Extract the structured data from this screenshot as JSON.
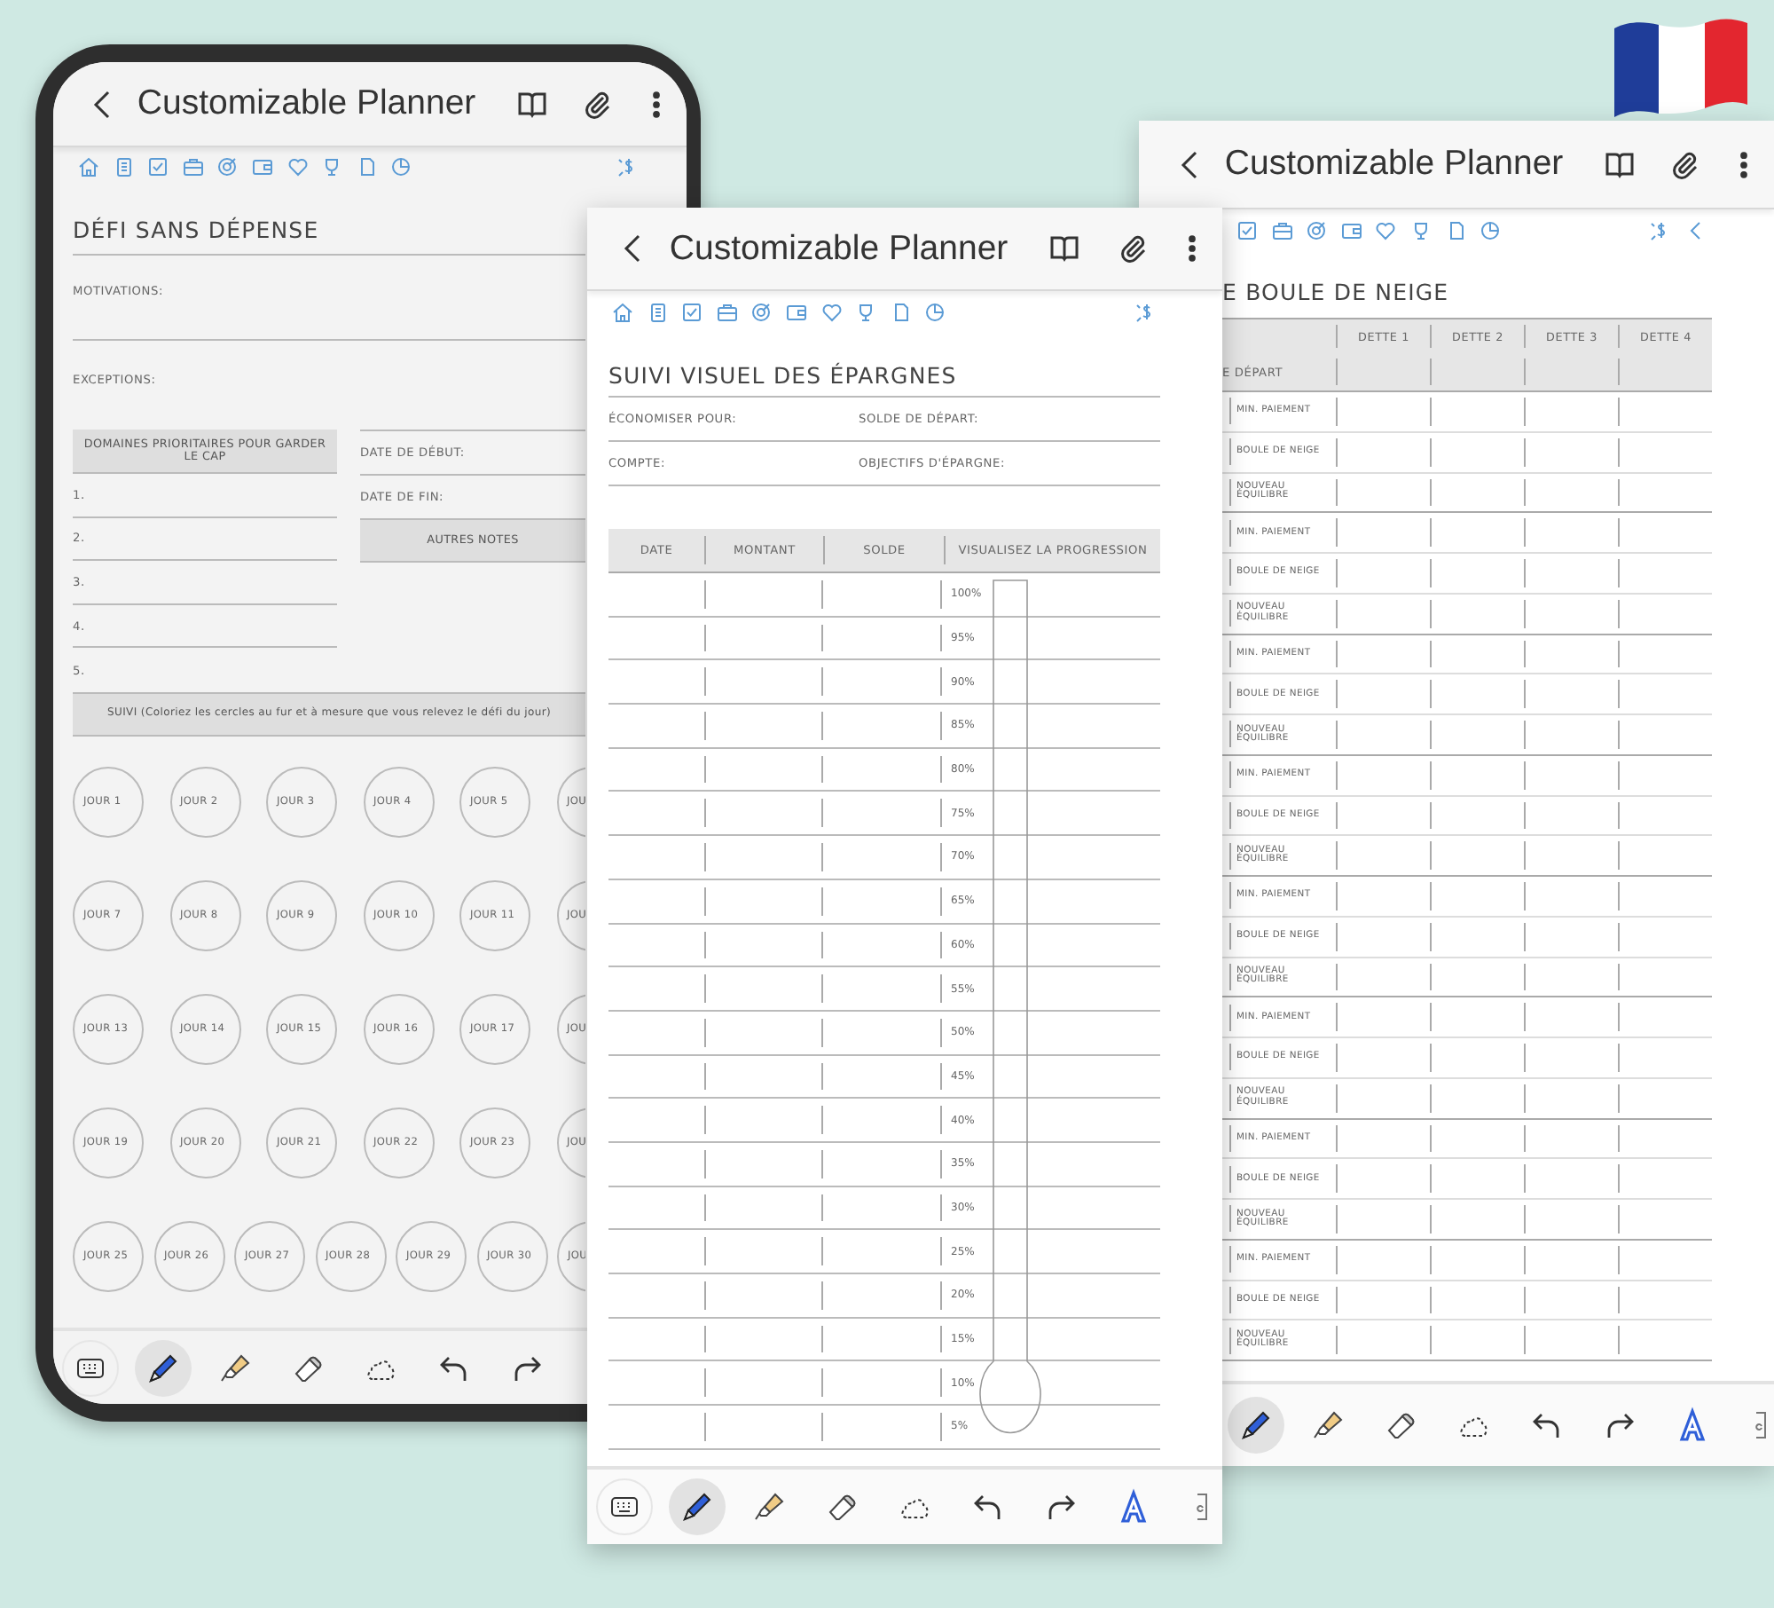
{
  "screens": [
    {
      "kind": "no_spend",
      "title": "Customizable Planner",
      "heading": "DÉFI SANS DÉPENSE",
      "notes": [
        "MOTIVATIONS:",
        "EXCEPTIONS:"
      ],
      "priorities": {
        "header": "DOMAINES PRIORITAIRES POUR GARDER LE CAP",
        "items": [
          "1.",
          "2.",
          "3.",
          "4.",
          "5."
        ]
      },
      "dates": [
        "DATE DE DÉBUT:",
        "DATE DE FIN:"
      ],
      "other_notes": "AUTRES NOTES",
      "tracker": {
        "header": "SUIVI (Coloriez les cercles au fur et à mesure que vous relevez le défi du jour)",
        "rows": [
          {
            "days": [
              "JOUR 1",
              "JOUR 2",
              "JOUR 3",
              "JOUR 4",
              "JOUR 5",
              "JOU"
            ]
          },
          {
            "days": [
              "JOUR 7",
              "JOUR 8",
              "JOUR 9",
              "JOUR 10",
              "JOUR 11",
              "JOU"
            ]
          },
          {
            "days": [
              "JOUR 13",
              "JOUR 14",
              "JOUR 15",
              "JOUR 16",
              "JOUR 17",
              "JOU"
            ]
          },
          {
            "days": [
              "JOUR 19",
              "JOUR 20",
              "JOUR 21",
              "JOUR 22",
              "JOUR 23",
              "JOU"
            ]
          },
          {
            "days": [
              "JOUR 25",
              "JOUR 26",
              "JOUR 27",
              "JOUR 28",
              "JOUR 29",
              "JOUR 30",
              "JOU"
            ]
          }
        ]
      },
      "toolbar": [
        {
          "kind": "keyboard",
          "selected": false
        },
        {
          "kind": "pen",
          "selected": true
        },
        {
          "kind": "highlighter",
          "selected": false
        },
        {
          "kind": "eraser",
          "selected": false
        },
        {
          "kind": "lasso",
          "selected": false
        },
        {
          "kind": "undo",
          "selected": false
        },
        {
          "kind": "redo",
          "selected": false
        }
      ]
    },
    {
      "kind": "snowball",
      "title": "Customizable Planner",
      "heading": "E BOULE DE NEIGE",
      "table": {
        "columns": [
          "DETTE 1",
          "DETTE 2",
          "DETTE 3",
          "DETTE 4"
        ],
        "start_row": "E DÉPART",
        "row_labels": [
          "MIN. PAIEMENT",
          "BOULE DE NEIGE",
          "NOUVEAU ÉQUILIBRE",
          "MIN. PAIEMENT",
          "BOULE DE NEIGE",
          "NOUVEAU ÉQUILIBRE",
          "MIN. PAIEMENT",
          "BOULE DE NEIGE",
          "NOUVEAU ÉQUILIBRE",
          "MIN. PAIEMENT",
          "BOULE DE NEIGE",
          "NOUVEAU ÉQUILIBRE",
          "MIN. PAIEMENT",
          "BOULE DE NEIGE",
          "NOUVEAU ÉQUILIBRE",
          "MIN. PAIEMENT",
          "BOULE DE NEIGE",
          "NOUVEAU ÉQUILIBRE",
          "MIN. PAIEMENT",
          "BOULE DE NEIGE",
          "NOUVEAU ÉQUILIBRE",
          "MIN. PAIEMENT",
          "BOULE DE NEIGE",
          "NOUVEAU ÉQUILIBRE"
        ]
      },
      "toolbar": [
        {
          "kind": "pen",
          "selected": true
        },
        {
          "kind": "highlighter",
          "selected": false
        },
        {
          "kind": "eraser",
          "selected": false
        },
        {
          "kind": "lasso",
          "selected": false
        },
        {
          "kind": "undo",
          "selected": false
        },
        {
          "kind": "redo",
          "selected": false
        },
        {
          "kind": "text_style",
          "selected": false
        },
        {
          "kind": "text_box",
          "selected": false
        }
      ]
    },
    {
      "kind": "savings",
      "title": "Customizable Planner",
      "heading": "SUIVI VISUEL DES ÉPARGNES",
      "fields": [
        [
          "ÉCONOMISER POUR:",
          "SOLDE DE DÉPART:"
        ],
        [
          "COMPTE:",
          "OBJECTIFS D'ÉPARGNE:"
        ]
      ],
      "table": {
        "columns": [
          "DATE",
          "MONTANT",
          "SOLDE",
          "VISUALISEZ LA PROGRESSION"
        ],
        "progress_labels": [
          "100%",
          "95%",
          "90%",
          "85%",
          "80%",
          "75%",
          "70%",
          "65%",
          "60%",
          "55%",
          "50%",
          "45%",
          "40%",
          "35%",
          "30%",
          "25%",
          "20%",
          "15%",
          "10%",
          "5%"
        ]
      },
      "toolbar": [
        {
          "kind": "keyboard",
          "selected": false
        },
        {
          "kind": "pen",
          "selected": true
        },
        {
          "kind": "highlighter",
          "selected": false
        },
        {
          "kind": "eraser",
          "selected": false
        },
        {
          "kind": "lasso",
          "selected": false
        },
        {
          "kind": "undo",
          "selected": false
        },
        {
          "kind": "redo",
          "selected": false
        },
        {
          "kind": "text_style",
          "selected": false
        },
        {
          "kind": "text_box",
          "selected": false
        }
      ]
    }
  ]
}
